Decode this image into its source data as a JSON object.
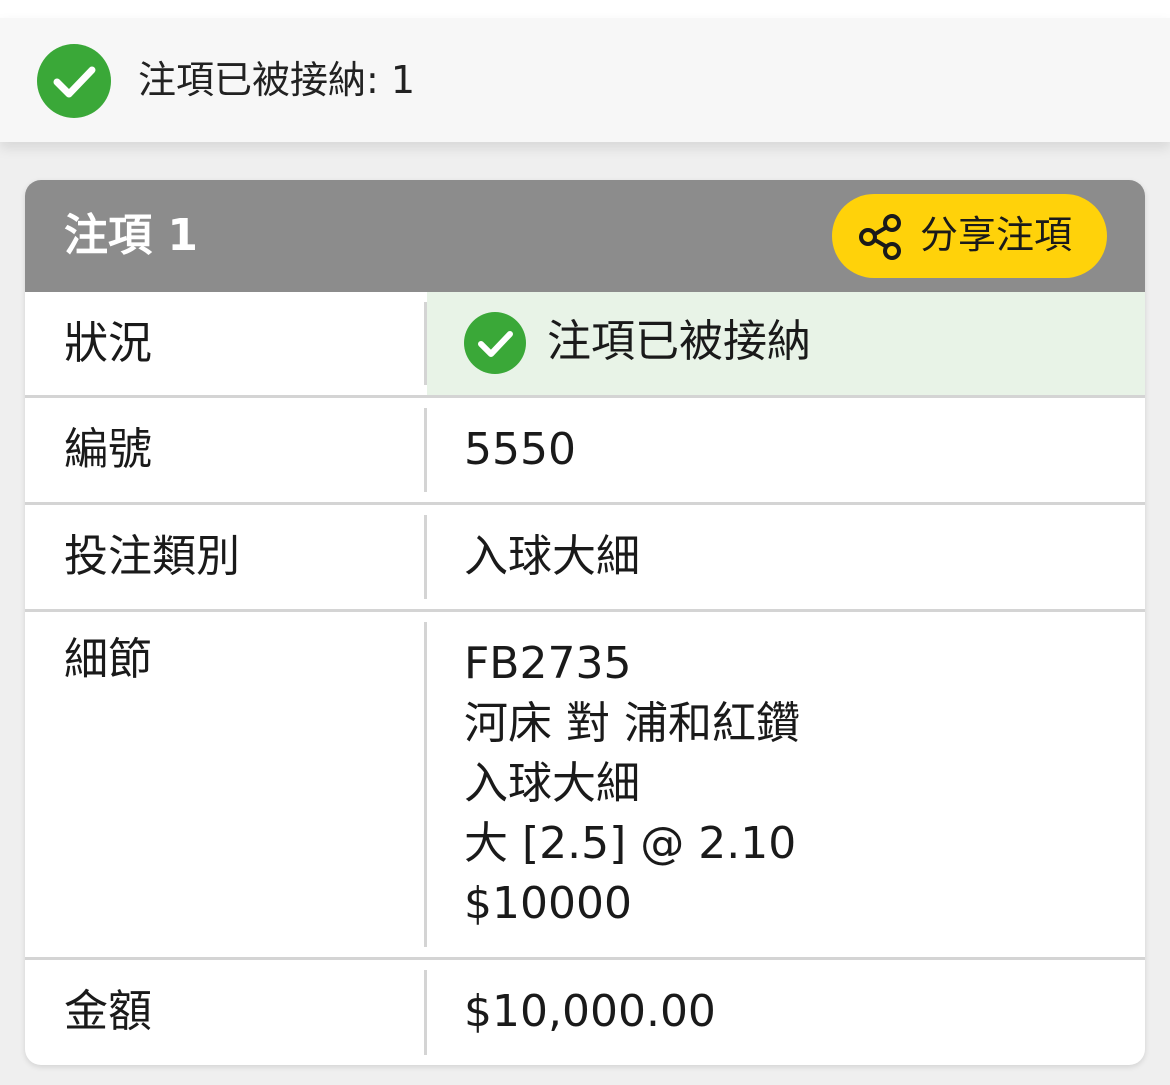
{
  "banner": {
    "icon": "check-circle-icon",
    "text": "注項已被接納: 1"
  },
  "card": {
    "title": "注項 1",
    "share_button": {
      "icon": "share-icon",
      "label": "分享注項"
    },
    "rows": {
      "status": {
        "label": "狀況",
        "icon": "check-circle-icon",
        "value": "注項已被接納"
      },
      "ref_no": {
        "label": "編號",
        "value": "5550"
      },
      "bet_type": {
        "label": "投注類別",
        "value": "入球大細"
      },
      "details": {
        "label": "細節",
        "lines": [
          "FB2735",
          "河床 對 浦和紅鑽",
          "入球大細",
          "大 [2.5] @ 2.10",
          "$10000"
        ]
      },
      "amount": {
        "label": "金額",
        "value": "$10,000.00"
      }
    }
  },
  "colors": {
    "success_green": "#3aa838",
    "header_grey": "#8c8c8c",
    "share_yellow": "#ffd20a",
    "status_bg": "#e8f3e7"
  }
}
